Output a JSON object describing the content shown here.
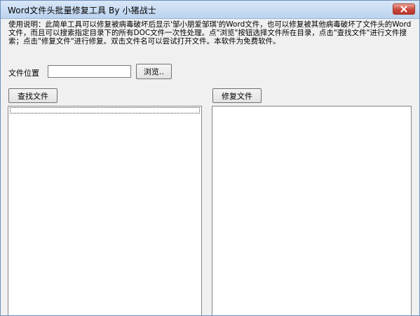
{
  "window": {
    "title": "Word文件头批量修复工具  By 小猪战士"
  },
  "instructions": {
    "text": "使用说明：此简单工具可以修复被病毒破坏后显示'邹小朋爱邹琪'的Word文件，也可以修复被其他病毒破坏了文件头的Word文件，而且可以搜索指定目录下的所有DOC文件一次性处理。点\"浏览\"按钮选择文件所在目录，点击\"查找文件\"进行文件搜索；点击\"修复文件\"进行修复。双击文件名可以尝试打开文件。本软件为免费软件。"
  },
  "path_section": {
    "label": "文件位置",
    "value": "",
    "browse_label": "浏览.."
  },
  "actions": {
    "find_label": "查找文件",
    "repair_label": "修复文件"
  },
  "colors": {
    "titlebar": "#bcd3ee",
    "close_button": "#c9463a",
    "client_background": "#f0f0f0",
    "list_background": "#ffffff"
  },
  "icons": {
    "close": "close-icon"
  }
}
